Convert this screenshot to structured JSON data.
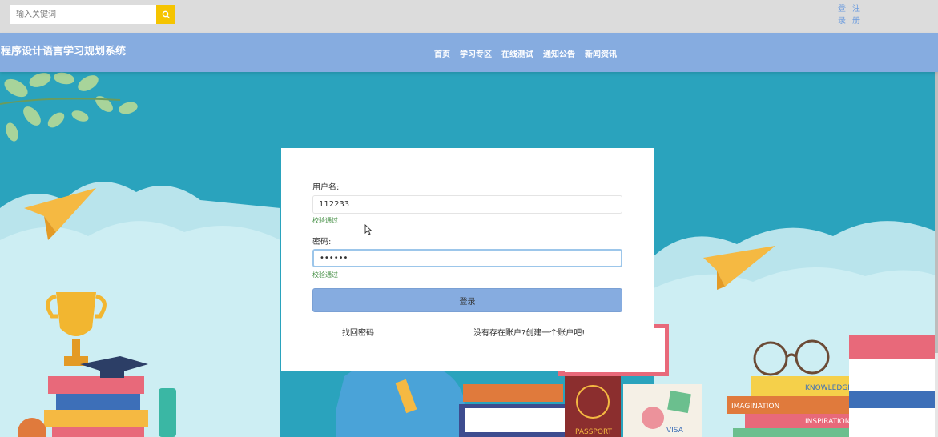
{
  "search": {
    "placeholder": "输入关键词"
  },
  "auth": {
    "login": "登录",
    "register": "注册"
  },
  "site": {
    "title": "程序设计语言学习规划系统"
  },
  "nav": {
    "items": [
      "首页",
      "学习专区",
      "在线测试",
      "通知公告",
      "新闻资讯"
    ]
  },
  "login_form": {
    "username_label": "用户名:",
    "username_value": "112233",
    "username_valid": "校验通过",
    "password_label": "密码:",
    "password_value": "123456",
    "password_valid": "校验通过",
    "submit_label": "登录",
    "forgot_link": "找回密码",
    "register_link": "没有存在账户?创建一个账户吧!"
  },
  "illustration": {
    "books_labels": [
      "KNOWLEDGE",
      "IMAGINATION",
      "INSPIRATION",
      "PASSPORT",
      "VISA"
    ]
  },
  "colors": {
    "background": "#2aa3bd",
    "navbar": "#86ace0",
    "search_button": "#f5c400",
    "valid_text": "#3c8a3c"
  }
}
